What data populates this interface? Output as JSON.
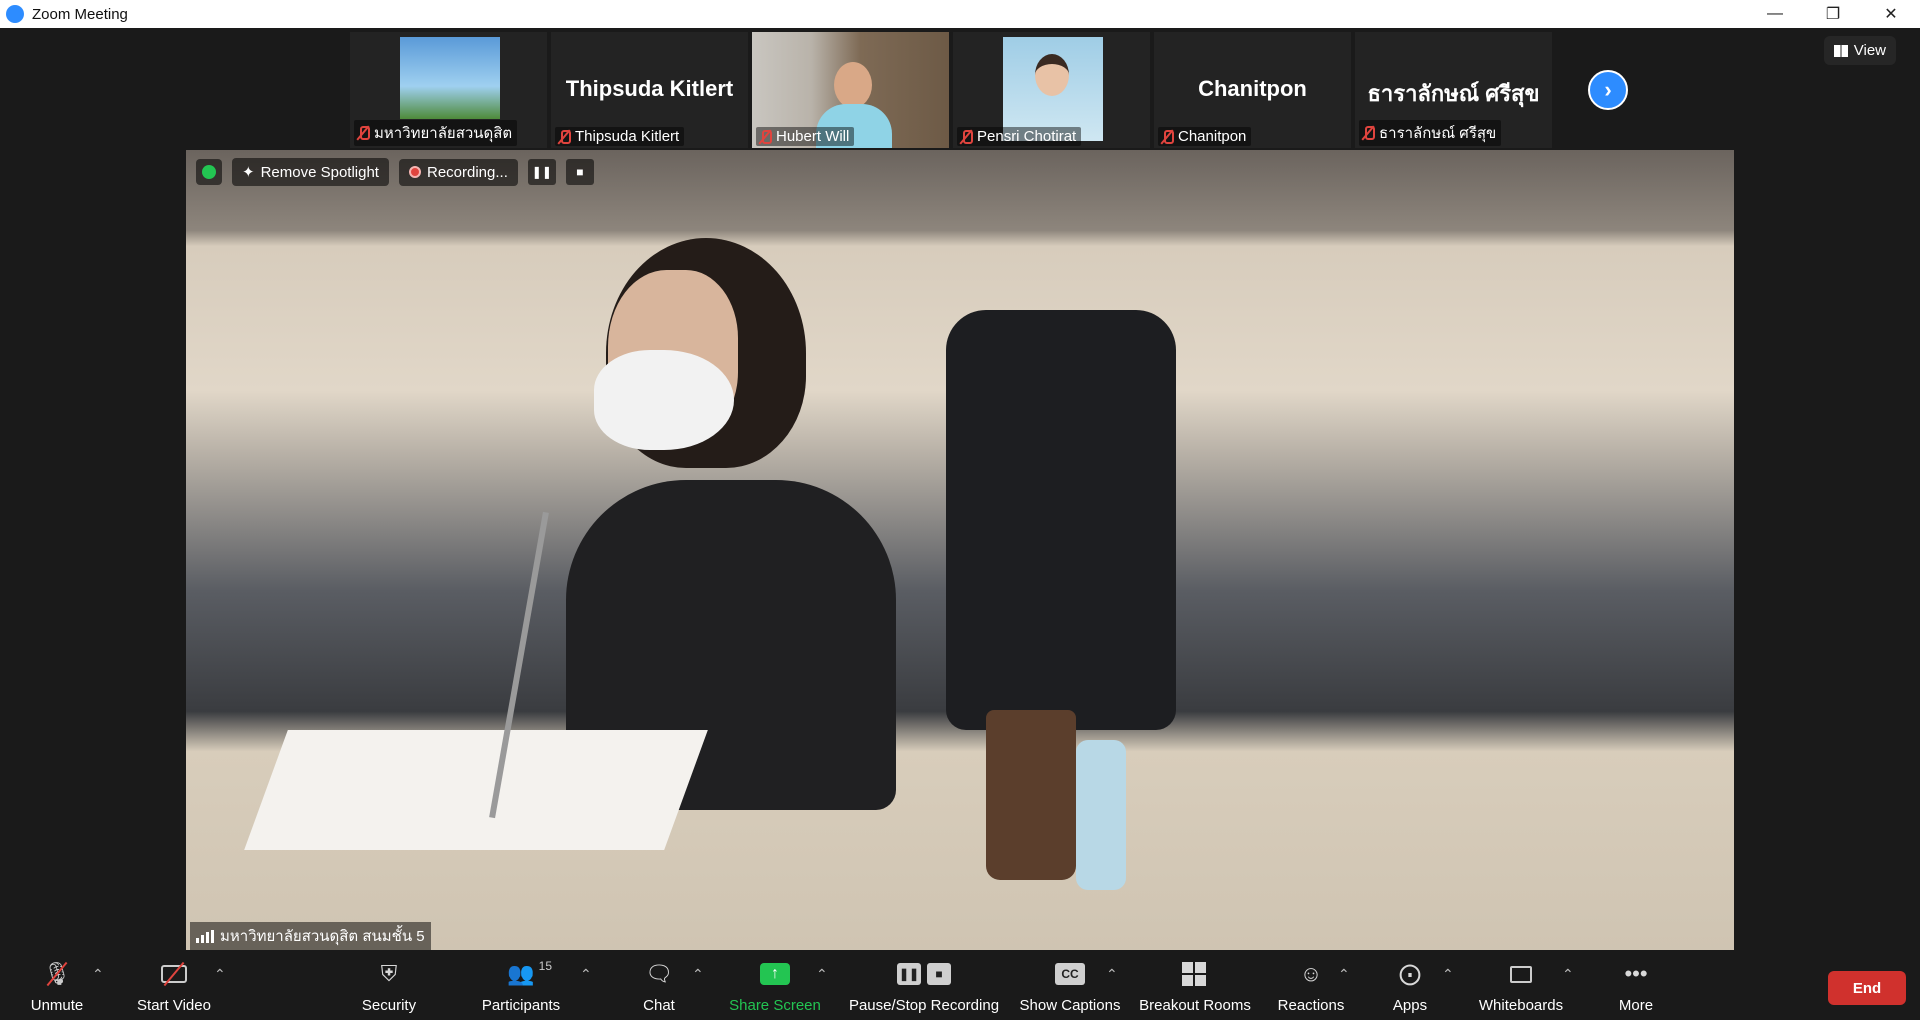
{
  "window": {
    "title": "Zoom Meeting"
  },
  "gallery": {
    "view_label": "View",
    "participants": [
      {
        "display_name": "",
        "name": "มหาวิทยาลัยสวนดุสิต",
        "has_image": true
      },
      {
        "display_name": "Thipsuda Kitlert",
        "name": "Thipsuda Kitlert",
        "has_image": false
      },
      {
        "display_name": "",
        "name": "Hubert Will",
        "has_image": true
      },
      {
        "display_name": "",
        "name": "Pensri Chotirat",
        "has_image": true
      },
      {
        "display_name": "Chanitpon",
        "name": "Chanitpon",
        "has_image": false
      },
      {
        "display_name": "ธาราลักษณ์ ศรีสุข",
        "name": "ธาราลักษณ์ ศรีสุข",
        "has_image": false
      }
    ]
  },
  "main": {
    "remove_spotlight": "Remove Spotlight",
    "recording": "Recording...",
    "speaker_name": "มหาวิทยาลัยสวนดุสิต สนมชั้น 5"
  },
  "toolbar": {
    "unmute": "Unmute",
    "start_video": "Start Video",
    "security": "Security",
    "participants": "Participants",
    "participants_count": "15",
    "chat": "Chat",
    "share_screen": "Share Screen",
    "pause_stop_recording": "Pause/Stop Recording",
    "show_captions": "Show Captions",
    "breakout_rooms": "Breakout Rooms",
    "reactions": "Reactions",
    "apps": "Apps",
    "whiteboards": "Whiteboards",
    "more": "More",
    "end": "End"
  },
  "colors": {
    "accent": "#2d8cff",
    "share": "#23c552",
    "end": "#d0312d",
    "muted": "#e0443e"
  }
}
